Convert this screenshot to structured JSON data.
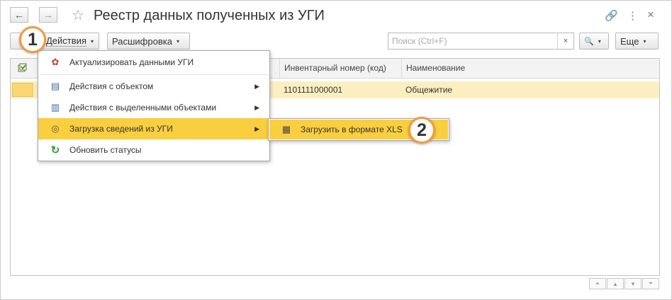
{
  "window": {
    "title": "Реестр данных полученных из УГИ",
    "back_icon": "←",
    "forward_icon": "→",
    "star_icon": "☆",
    "link_icon": "🔗",
    "more_icon": "⋮",
    "close_icon": "×"
  },
  "toolbar": {
    "actions_label": "Действия",
    "decode_label": "Расшифровка",
    "search_placeholder": "Поиск (Ctrl+F)",
    "search_value": "",
    "clear_label": "×",
    "search_icon": "🔍",
    "more_label": "Еще",
    "caret": "▾"
  },
  "callouts": {
    "one": "1",
    "two": "2"
  },
  "table": {
    "columns": [
      "Инвентарный номер (код)",
      "Наименование"
    ],
    "rows": [
      {
        "inventory_number": "1101111000001",
        "name": "Общежитие"
      }
    ]
  },
  "menu": {
    "items": [
      {
        "label": "Актуализировать данными УГИ",
        "icon": "✿"
      },
      {
        "label": "Действия с объектом",
        "icon": "▤",
        "arrow": "▶"
      },
      {
        "label": "Действия с выделенными объектами",
        "icon": "▥",
        "arrow": "▶"
      },
      {
        "label": "Загрузка сведений из УГИ",
        "icon": "◎",
        "arrow": "▶"
      },
      {
        "label": "Обновить статусы",
        "icon": "↻"
      }
    ]
  },
  "submenu": {
    "items": [
      {
        "label": "Загрузить в формате XLS",
        "icon": "▦"
      }
    ]
  },
  "scroll": {
    "first": "⏶",
    "up": "▲",
    "down": "▼",
    "last": "⏷"
  },
  "colors": {
    "highlight": "#f9cf3f",
    "selected_row": "#fbefc2",
    "callout_border": "#f39a3d"
  }
}
